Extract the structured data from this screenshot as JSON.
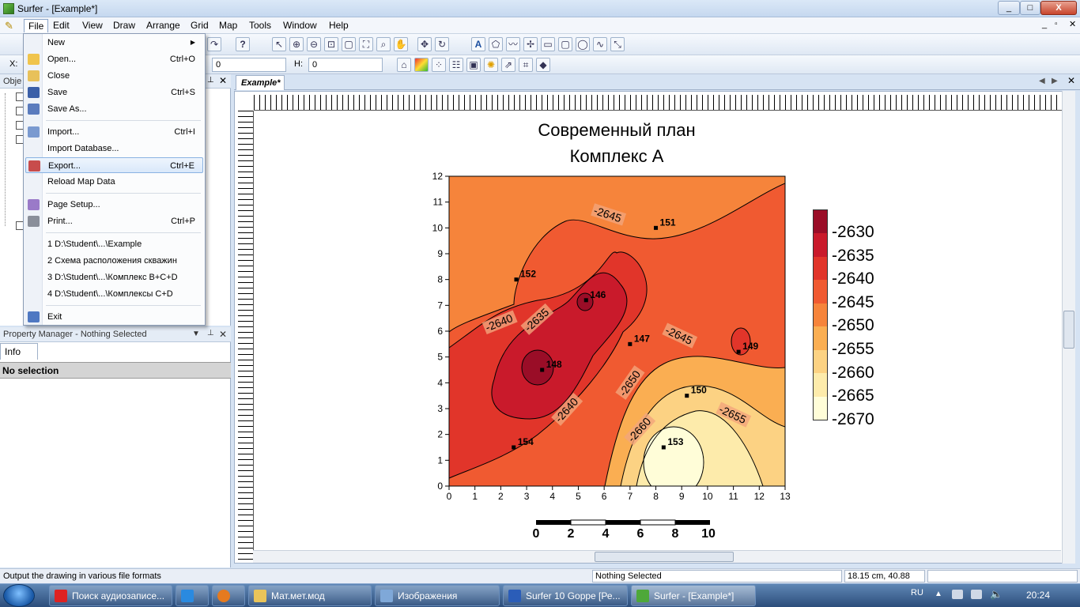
{
  "window": {
    "title": "Surfer - [Example*]",
    "min": "_",
    "max": "□",
    "close": "X"
  },
  "menubar": [
    "File",
    "Edit",
    "View",
    "Draw",
    "Arrange",
    "Grid",
    "Map",
    "Tools",
    "Window",
    "Help"
  ],
  "toolbar2": {
    "x_label": "X:",
    "y_value": "0",
    "h_label": "H:",
    "h_value": "0"
  },
  "object_manager": {
    "title": "Obje"
  },
  "property_manager": {
    "title": "Property Manager - Nothing Selected",
    "tab": "Info",
    "selection": "No selection"
  },
  "file_menu": {
    "items": [
      {
        "label": "New",
        "shortcut": "",
        "submenu": true
      },
      {
        "label": "Open...",
        "shortcut": "Ctrl+O"
      },
      {
        "label": "Close",
        "shortcut": ""
      },
      {
        "label": "Save",
        "shortcut": "Ctrl+S"
      },
      {
        "label": "Save As...",
        "shortcut": ""
      },
      {
        "label": "Import...",
        "shortcut": "Ctrl+I"
      },
      {
        "label": "Import Database...",
        "shortcut": ""
      },
      {
        "label": "Export...",
        "shortcut": "Ctrl+E"
      },
      {
        "label": "Reload Map Data",
        "shortcut": ""
      },
      {
        "label": "Page Setup...",
        "shortcut": ""
      },
      {
        "label": "Print...",
        "shortcut": "Ctrl+P"
      },
      {
        "label": "1 D:\\Student\\...\\Example",
        "shortcut": ""
      },
      {
        "label": "2 Схема расположения скважин",
        "shortcut": ""
      },
      {
        "label": "3 D:\\Student\\...\\Комплекс В+С+D",
        "shortcut": ""
      },
      {
        "label": "4 D:\\Student\\...\\Комплексы С+D",
        "shortcut": ""
      },
      {
        "label": "Exit",
        "shortcut": ""
      }
    ]
  },
  "document": {
    "tab": "Example*"
  },
  "map": {
    "title_line1": "Современный план",
    "title_line2": "Комплекс А",
    "x_ticks": [
      "0",
      "1",
      "2",
      "3",
      "4",
      "5",
      "6",
      "7",
      "8",
      "9",
      "10",
      "11",
      "12",
      "13"
    ],
    "y_ticks": [
      "0",
      "1",
      "2",
      "3",
      "4",
      "5",
      "6",
      "7",
      "8",
      "9",
      "10",
      "11",
      "12"
    ],
    "wells": [
      {
        "id": "151",
        "x": 8.0,
        "y": 10.0
      },
      {
        "id": "152",
        "x": 2.6,
        "y": 8.0
      },
      {
        "id": "146",
        "x": 5.3,
        "y": 7.2
      },
      {
        "id": "147",
        "x": 7.0,
        "y": 5.5
      },
      {
        "id": "149",
        "x": 11.2,
        "y": 5.2
      },
      {
        "id": "148",
        "x": 3.6,
        "y": 4.5
      },
      {
        "id": "150",
        "x": 9.2,
        "y": 3.5
      },
      {
        "id": "154",
        "x": 2.5,
        "y": 1.5
      },
      {
        "id": "153",
        "x": 8.3,
        "y": 1.5
      }
    ],
    "contour_labels": [
      "-2645",
      "-2640",
      "-2635",
      "-2645",
      "-2650",
      "-2640",
      "-2655",
      "-2660"
    ],
    "colorbar_labels": [
      "-2630",
      "-2635",
      "-2640",
      "-2645",
      "-2650",
      "-2655",
      "-2660",
      "-2665",
      "-2670"
    ],
    "colorbar_colors": [
      "#9a0d27",
      "#c91a2b",
      "#e1352a",
      "#f05a31",
      "#f6843b",
      "#faae52",
      "#fcd283",
      "#fdebab",
      "#fffdd8"
    ],
    "scale_labels": [
      "0",
      "2",
      "4",
      "6",
      "8",
      "10"
    ]
  },
  "statusbar": {
    "hint": "Output the drawing in various file formats",
    "selection": "Nothing Selected",
    "coords": "18.15 cm, 40.88 cm"
  },
  "taskbar": {
    "tasks": [
      "Поиск аудиозаписе...",
      "",
      "",
      "Мат.мет.мод",
      "Изображения",
      "Surfer 10 Goppe [Ре...",
      "Surfer - [Example*]"
    ],
    "lang": "RU",
    "time": "20:24"
  }
}
